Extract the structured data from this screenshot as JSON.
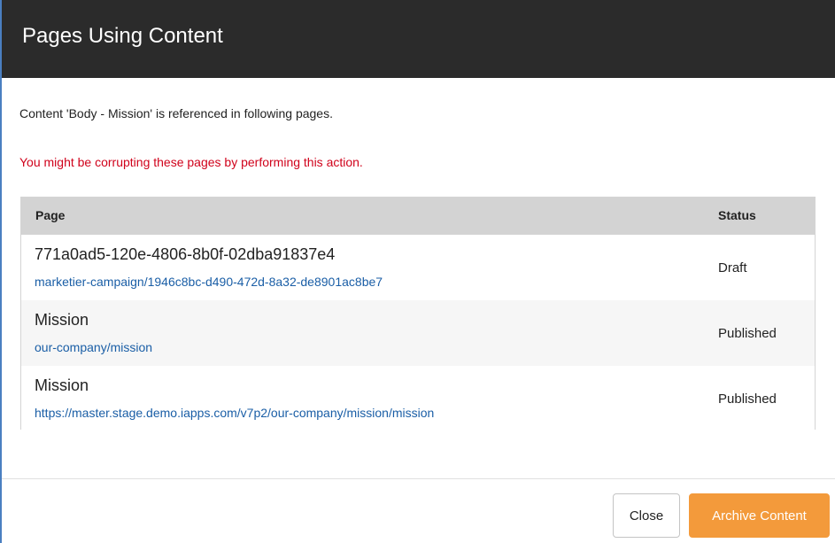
{
  "dialog": {
    "title": "Pages Using Content",
    "intro": "Content 'Body - Mission' is referenced in following pages.",
    "warning": "You might be corrupting these pages by performing this action."
  },
  "table": {
    "columns": {
      "page": "Page",
      "status": "Status"
    },
    "rows": [
      {
        "title": "771a0ad5-120e-4806-8b0f-02dba91837e4",
        "link": "marketier-campaign/1946c8bc-d490-472d-8a32-de8901ac8be7",
        "status": "Draft"
      },
      {
        "title": "Mission",
        "link": "our-company/mission",
        "status": "Published"
      },
      {
        "title": "Mission",
        "link": "https://master.stage.demo.iapps.com/v7p2/our-company/mission/mission",
        "status": "Published"
      }
    ]
  },
  "footer": {
    "close_label": "Close",
    "archive_label": "Archive Content"
  },
  "colors": {
    "header_bg": "#2b2b2b",
    "warning": "#d0021b",
    "link": "#1a5ea6",
    "primary_button": "#f39a3b"
  }
}
